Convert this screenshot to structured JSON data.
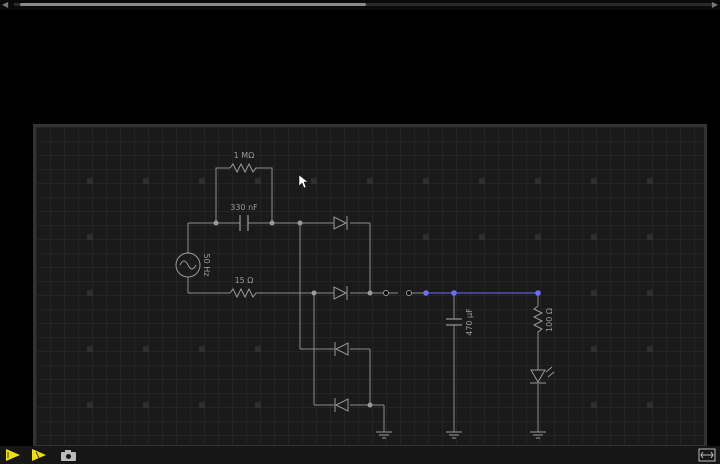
{
  "labels": {
    "r1": "1 MΩ",
    "c1": "330 nF",
    "source": "50 Hz",
    "r2": "15 Ω",
    "c2": "470 μF",
    "r3": "100 Ω"
  },
  "toolbar": {
    "play_icon": "play-icon",
    "step_icon": "step-icon",
    "camera_icon": "camera-icon",
    "fit_icon": "fit-icon"
  },
  "colors": {
    "wire": "#8c8c8c",
    "active_wire": "#6f6cff",
    "node": "#9a9a9a",
    "accent": "#f0e000"
  }
}
